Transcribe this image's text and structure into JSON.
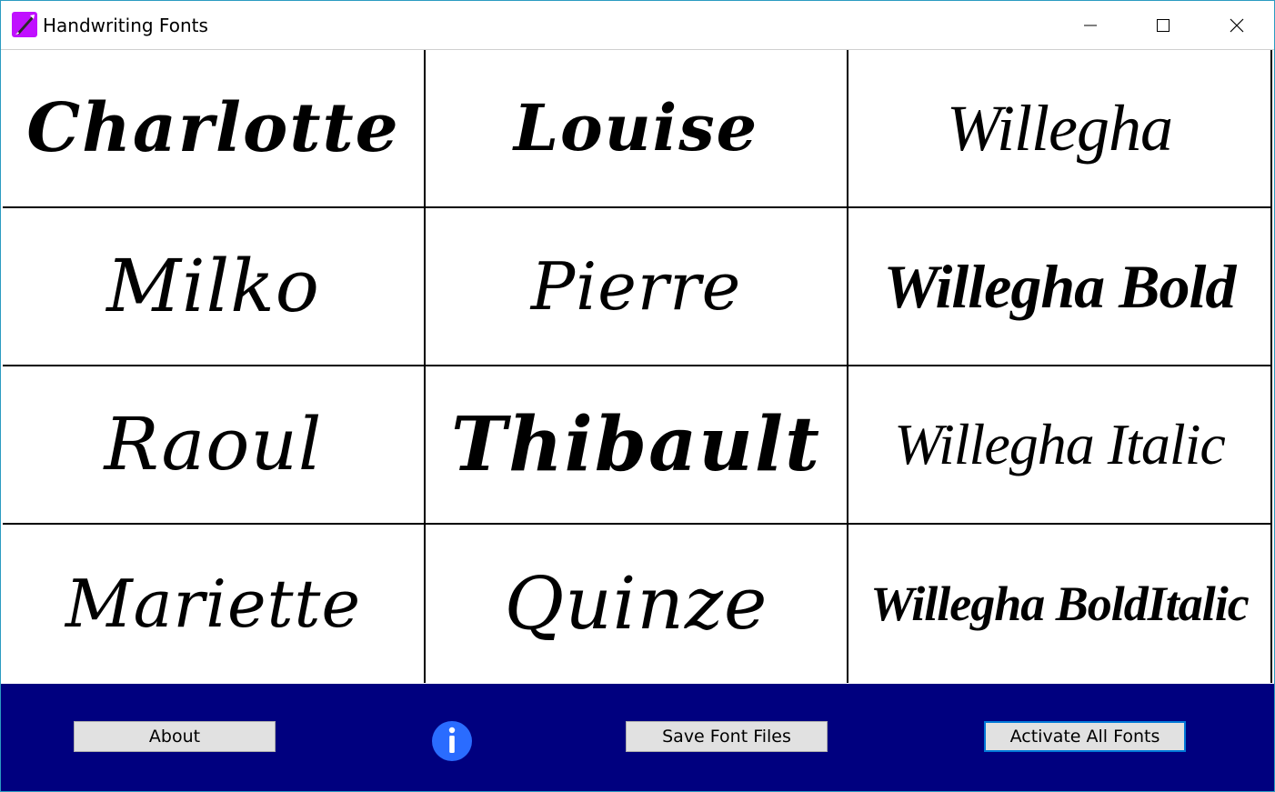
{
  "window": {
    "title": "Handwriting Fonts",
    "icon": "quill-pen-icon",
    "controls": [
      "minimize-icon",
      "maximize-icon",
      "close-icon"
    ]
  },
  "fonts": [
    [
      "Charlotte",
      "Louise",
      "Willegha"
    ],
    [
      "Milko",
      "Pierre",
      "Willegha Bold"
    ],
    [
      "Raoul",
      "Thibault",
      "Willegha Italic"
    ],
    [
      "Mariette",
      "Quinze",
      "Willegha BoldItalic"
    ]
  ],
  "toolbar": {
    "about_label": "About",
    "info_icon": "info-icon",
    "save_label": "Save Font Files",
    "activate_label": "Activate All Fonts"
  },
  "colors": {
    "bottom_bar": "#00007f",
    "info_icon": "#2a6cff",
    "app_icon": "#c010ff",
    "focus_border": "#0078d7"
  }
}
